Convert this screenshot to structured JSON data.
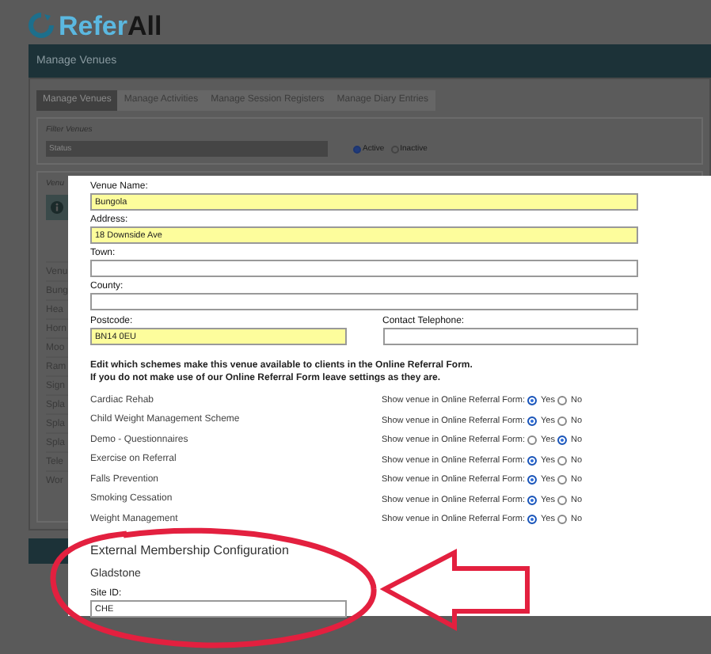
{
  "logo": {
    "brand_first": "Refer",
    "brand_second": "All"
  },
  "header": {
    "title": "Manage Venues"
  },
  "tabs": [
    {
      "label": "Manage Venues",
      "selected": true
    },
    {
      "label": "Manage Activities",
      "selected": false
    },
    {
      "label": "Manage Session Registers",
      "selected": false
    },
    {
      "label": "Manage Diary Entries",
      "selected": false
    }
  ],
  "filter": {
    "legend": "Filter Venues",
    "placeholder": "Status",
    "radios": [
      {
        "label": "Active",
        "selected": true
      },
      {
        "label": "Inactive",
        "selected": false
      }
    ]
  },
  "venue_list": {
    "legend": "Venu",
    "column_header": "Venu",
    "rows": [
      "Bung",
      "Hea",
      "Horn",
      "Moo",
      "Ram",
      "Sign",
      "Spla",
      "Spla",
      "Spla",
      "Tele",
      "Wor"
    ]
  },
  "modal": {
    "fields": [
      {
        "label": "Venue Name:",
        "value": "Bungola",
        "required": true,
        "kind": "full"
      },
      {
        "label": "Address:",
        "value": "18 Downside Ave",
        "required": true,
        "kind": "full"
      },
      {
        "label": "Town:",
        "required": false,
        "kind": "full"
      },
      {
        "label": "County:",
        "required": false,
        "kind": "full"
      },
      {
        "label": "Postcode:",
        "value": "BN14 0EU",
        "required": true,
        "kind": "half"
      },
      {
        "label": "Contact Telephone:",
        "required": false,
        "kind": "half"
      }
    ],
    "intro": [
      "Edit which schemes make this venue available to clients in the Online Referral Form.",
      "If you do not make use of our Online Referral Form leave settings as they are."
    ],
    "schemes": [
      {
        "name": "Cardiac Rehab",
        "question": "Show venue in Online Referral Form:",
        "options": [
          {
            "label": "Yes",
            "selected": true
          },
          {
            "label": "No",
            "selected": false
          }
        ]
      },
      {
        "name": "Child Weight Management Scheme",
        "question": "Show venue in Online Referral Form:",
        "options": [
          {
            "label": "Yes",
            "selected": true
          },
          {
            "label": "No",
            "selected": false
          }
        ]
      },
      {
        "name": "Demo - Questionnaires",
        "question": "Show venue in Online Referral Form:",
        "options": [
          {
            "label": "Yes",
            "selected": false
          },
          {
            "label": "No",
            "selected": true
          }
        ]
      },
      {
        "name": "Exercise on Referral",
        "question": "Show venue in Online Referral Form:",
        "options": [
          {
            "label": "Yes",
            "selected": true
          },
          {
            "label": "No",
            "selected": false
          }
        ]
      },
      {
        "name": "Falls Prevention",
        "question": "Show venue in Online Referral Form:",
        "options": [
          {
            "label": "Yes",
            "selected": true
          },
          {
            "label": "No",
            "selected": false
          }
        ]
      },
      {
        "name": "Smoking Cessation",
        "question": "Show venue in Online Referral Form:",
        "options": [
          {
            "label": "Yes",
            "selected": true
          },
          {
            "label": "No",
            "selected": false
          }
        ]
      },
      {
        "name": "Weight Management",
        "question": "Show venue in Online Referral Form:",
        "options": [
          {
            "label": "Yes",
            "selected": true
          },
          {
            "label": "No",
            "selected": false
          }
        ]
      }
    ],
    "external": {
      "title": "External Membership Configuration",
      "provider": "Gladstone",
      "field": {
        "label": "Site ID:",
        "value": "CHE"
      }
    }
  }
}
